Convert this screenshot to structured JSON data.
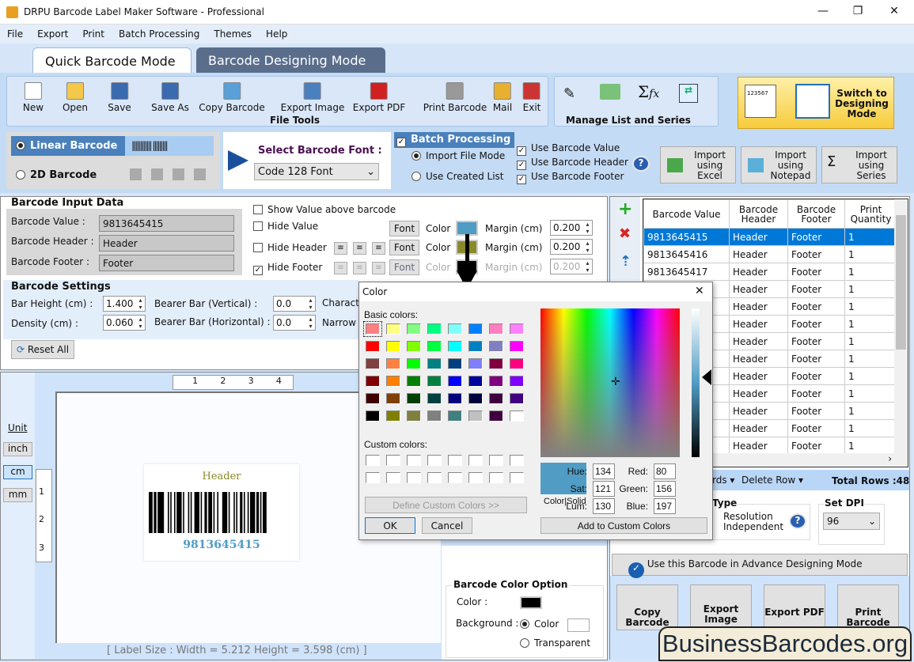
{
  "window": {
    "title": "DRPU Barcode Label Maker Software - Professional"
  },
  "menu": [
    "File",
    "Export",
    "Print",
    "Batch Processing",
    "Themes",
    "Help"
  ],
  "tabs": [
    "Quick Barcode Mode",
    "Barcode Designing Mode"
  ],
  "file_tools": {
    "label": "File Tools",
    "items": [
      "New",
      "Open",
      "Save",
      "Save As",
      "Copy Barcode",
      "Export Image",
      "Export PDF",
      "Print Barcode",
      "Mail",
      "Exit"
    ]
  },
  "manage": {
    "label": "Manage List and Series"
  },
  "switch_mode": {
    "label": "Switch to Designing Mode",
    "sample": "123567"
  },
  "barcode_type": {
    "linear": "Linear Barcode",
    "twod": "2D Barcode"
  },
  "font_select": {
    "label": "Select Barcode Font :",
    "value": "Code 128 Font"
  },
  "batch": {
    "title": "Batch Processing",
    "import_file": "Import File Mode",
    "use_list": "Use Created List",
    "use_value": "Use Barcode Value",
    "use_header": "Use Barcode Header",
    "use_footer": "Use Barcode Footer"
  },
  "imports": [
    "Import using Excel",
    "Import using Notepad",
    "Import using Series"
  ],
  "input_data": {
    "title": "Barcode Input Data",
    "value_label": "Barcode Value :",
    "value": "9813645415",
    "header_label": "Barcode Header :",
    "header": "Header",
    "footer_label": "Barcode Footer :",
    "footer": "Footer"
  },
  "options": {
    "show_above": "Show Value above barcode",
    "hide_value": "Hide Value",
    "hide_header": "Hide Header",
    "hide_footer": "Hide Footer",
    "font": "Font",
    "color": "Color",
    "margin": "Margin (cm)",
    "margin_value": "0.200",
    "margin_header": "0.200",
    "margin_footer": "0.200",
    "value_color": "#4f9cc5",
    "header_color": "#8a8a28",
    "footer_color": "#000000"
  },
  "settings": {
    "title": "Barcode Settings",
    "bar_height_label": "Bar Height (cm) :",
    "bar_height": "1.400",
    "density_label": "Density (cm) :",
    "density": "0.060",
    "bearer_v_label": "Bearer Bar (Vertical) :",
    "bearer_v": "0.0",
    "bearer_h_label": "Bearer Bar (Horizontal) :",
    "bearer_h": "0.0",
    "charact": "Charact",
    "narrow": "Narrow",
    "reset": "Reset All"
  },
  "units": {
    "label": "Unit",
    "items": [
      "inch",
      "cm",
      "mm"
    ],
    "selected": "cm"
  },
  "ruler": {
    "h": [
      "1",
      "2",
      "3",
      "4"
    ],
    "v": [
      "1",
      "2",
      "3"
    ]
  },
  "preview": {
    "header": "Header",
    "value": "9813645415",
    "label_size": "[ Label Size : Width =  5.212  Height = 3.598 (cm) ]"
  },
  "color_option": {
    "title": "Barcode Color Option",
    "color_label": "Color :",
    "bg_label": "Background :",
    "bg_color": "Color",
    "transparent": "Transparent",
    "bar_color": "#000000",
    "bg_value": "#ffffff"
  },
  "table": {
    "headers": [
      "Barcode Value",
      "Barcode Header",
      "Barcode Footer",
      "Print Quantity"
    ],
    "rows": [
      [
        "9813645415",
        "Header",
        "Footer",
        "1"
      ],
      [
        "9813645416",
        "Header",
        "Footer",
        "1"
      ],
      [
        "9813645417",
        "Header",
        "Footer",
        "1"
      ],
      [
        "",
        "Header",
        "Footer",
        "1"
      ],
      [
        "",
        "Header",
        "Footer",
        "1"
      ],
      [
        "",
        "Header",
        "Footer",
        "1"
      ],
      [
        "",
        "Header",
        "Footer",
        "1"
      ],
      [
        "",
        "Header",
        "Footer",
        "1"
      ],
      [
        "",
        "Header",
        "Footer",
        "1"
      ],
      [
        "",
        "Header",
        "Footer",
        "1"
      ],
      [
        "",
        "Header",
        "Footer",
        "1"
      ],
      [
        "",
        "Header",
        "Footer",
        "1"
      ],
      [
        "",
        "Header",
        "Footer",
        "1"
      ]
    ],
    "records": "rds ▾",
    "delete_row": "Delete Row ▾",
    "total": "Total Rows :48"
  },
  "type_box": {
    "title": "Type",
    "option": "Resolution Independent"
  },
  "dpi": {
    "title": "Set DPI",
    "value": "96"
  },
  "advance": "Use this Barcode in Advance Designing Mode",
  "bottom_buttons": [
    "Copy Barcode",
    "Export Image",
    "Export PDF",
    "Print Barcode"
  ],
  "watermark": "BusinessBarcodes.org",
  "color_dialog": {
    "title": "Color",
    "basic": "Basic colors:",
    "custom": "Custom colors:",
    "define": "Define Custom Colors >>",
    "ok": "OK",
    "cancel": "Cancel",
    "add": "Add to Custom Colors",
    "color_solid": "Color|Solid",
    "hue_label": "Hue:",
    "hue": "134",
    "sat_label": "Sat:",
    "sat": "121",
    "lum_label": "Lum:",
    "lum": "130",
    "red_label": "Red:",
    "red": "80",
    "green_label": "Green:",
    "green": "156",
    "blue_label": "Blue:",
    "blue": "197",
    "current": "#509cc5",
    "basic_colors": [
      "#FF8080",
      "#FFFF80",
      "#80FF80",
      "#00FF80",
      "#80FFFF",
      "#0080FF",
      "#FF80C0",
      "#FF80FF",
      "#FF0000",
      "#FFFF00",
      "#80FF00",
      "#00FF40",
      "#00FFFF",
      "#0080C0",
      "#8080C0",
      "#FF00FF",
      "#804040",
      "#FF8040",
      "#00FF00",
      "#008080",
      "#004080",
      "#8080FF",
      "#800040",
      "#FF0080",
      "#800000",
      "#FF8000",
      "#008000",
      "#008040",
      "#0000FF",
      "#0000A0",
      "#800080",
      "#8000FF",
      "#400000",
      "#804000",
      "#004000",
      "#004040",
      "#000080",
      "#000040",
      "#400040",
      "#400080",
      "#000000",
      "#808000",
      "#808040",
      "#808080",
      "#408080",
      "#C0C0C0",
      "#400040",
      "#FFFFFF"
    ]
  }
}
